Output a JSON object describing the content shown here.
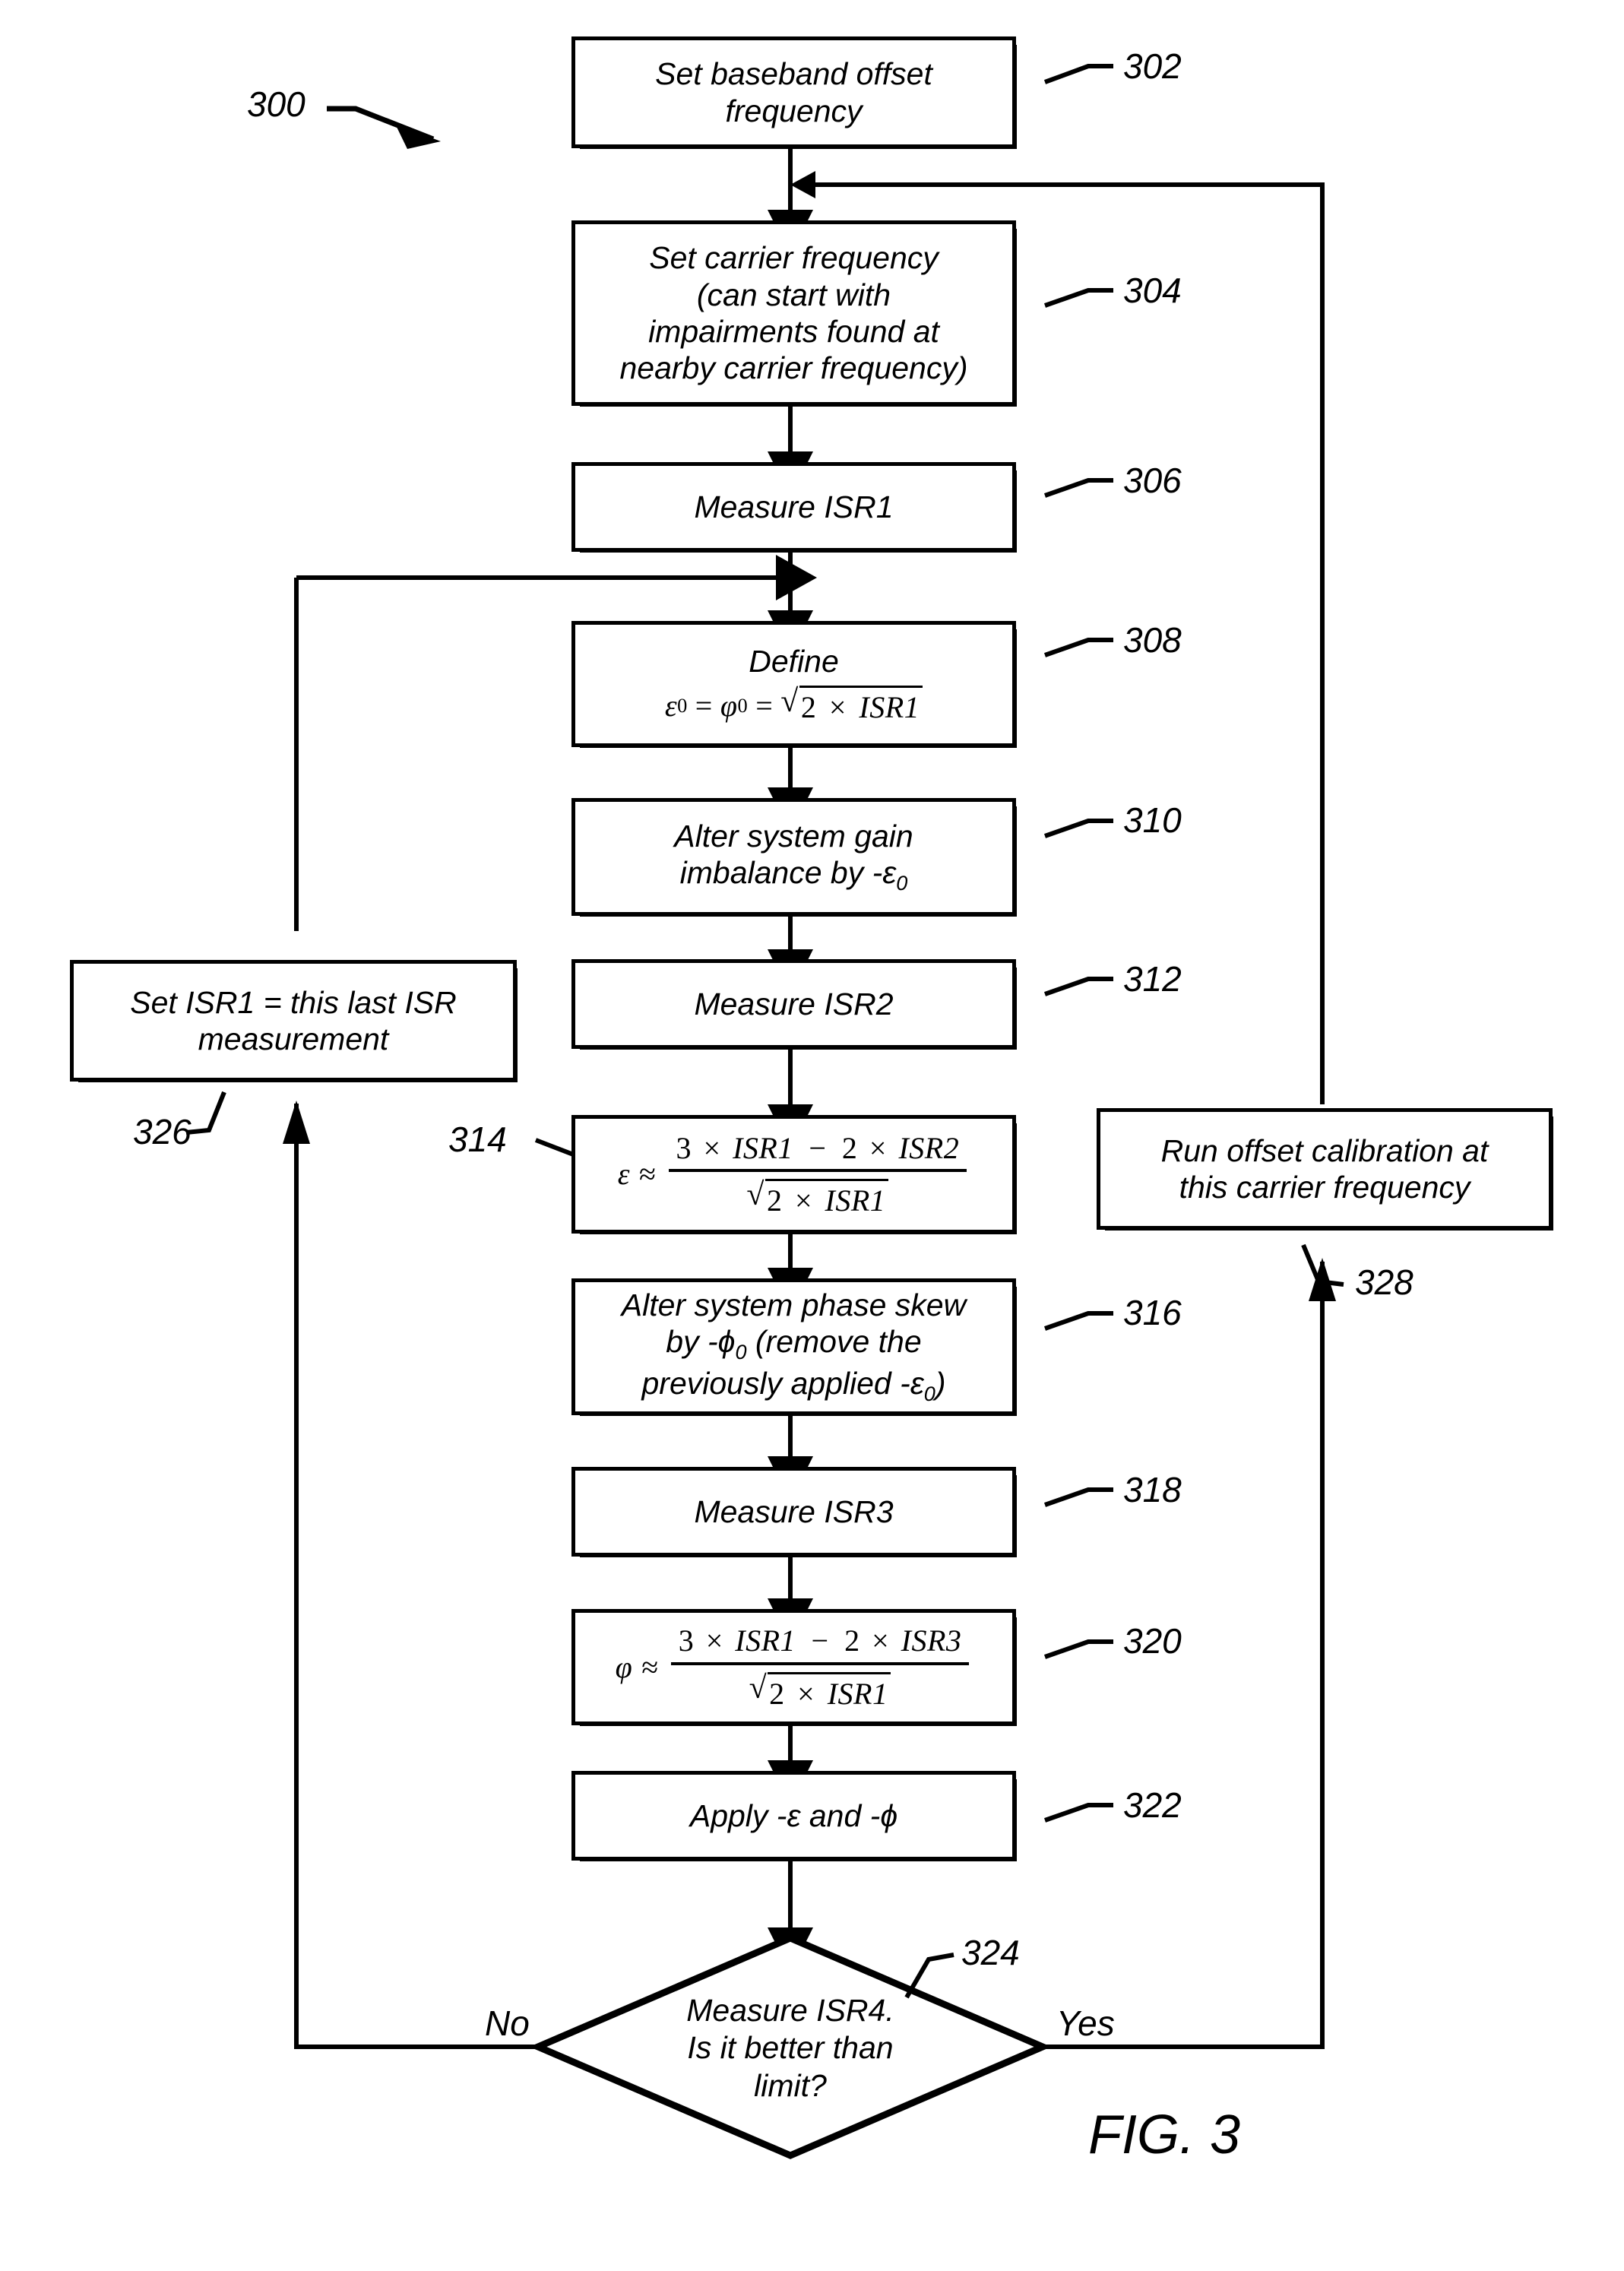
{
  "figure": {
    "caption": "FIG. 3",
    "diagram_ref": "300"
  },
  "nodes": [
    {
      "ref": "302",
      "name": "set-baseband-offset-frequency",
      "text": "Set baseband offset frequency"
    },
    {
      "ref": "304",
      "name": "set-carrier-frequency",
      "text": "Set carrier frequency (can start with impairments found at nearby carrier frequency)"
    },
    {
      "ref": "306",
      "name": "measure-isr1",
      "text": "Measure ISR1"
    },
    {
      "ref": "308",
      "name": "define-epsilon0-phi0",
      "text": "Define",
      "formula": "ε₀ = φ₀ = √(2 × ISR1)",
      "formula_parts": {
        "lhs": "ε",
        "lhs_sub": "0",
        "mid": "φ",
        "mid_sub": "0",
        "radicand": "2 × ISR1"
      }
    },
    {
      "ref": "310",
      "name": "alter-system-gain-imbalance",
      "text": "Alter system gain imbalance by -ε₀",
      "text_lines": [
        "Alter system gain",
        "imbalance by -ε",
        "0"
      ]
    },
    {
      "ref": "312",
      "name": "measure-isr2",
      "text": "Measure ISR2"
    },
    {
      "ref": "314",
      "name": "compute-epsilon",
      "formula": "ε ≈ (3 × ISR1 − 2 × ISR2) / √(2 × ISR1)",
      "formula_parts": {
        "lhs": "ε",
        "rel": "≈",
        "numerator": "3 × ISR1 − 2 × ISR2",
        "denominator_radicand": "2 × ISR1"
      }
    },
    {
      "ref": "316",
      "name": "alter-system-phase-skew",
      "text": "Alter system phase skew by -ϕ₀ (remove the previously applied -ε₀)"
    },
    {
      "ref": "318",
      "name": "measure-isr3",
      "text": "Measure ISR3"
    },
    {
      "ref": "320",
      "name": "compute-phi",
      "formula": "φ ≈ (3 × ISR1 − 2 × ISR3) / √(2 × ISR1)",
      "formula_parts": {
        "lhs": "φ",
        "rel": "≈",
        "numerator": "3 × ISR1 − 2 × ISR3",
        "denominator_radicand": "2 × ISR1"
      }
    },
    {
      "ref": "322",
      "name": "apply-epsilon-phi",
      "text": "Apply -ε and -ϕ"
    },
    {
      "ref": "324",
      "name": "measure-isr4-decision",
      "text": "Measure ISR4. Is it better than limit?",
      "shape": "decision"
    },
    {
      "ref": "326",
      "name": "set-isr1-last-measurement",
      "text": "Set ISR1 = this last ISR measurement"
    },
    {
      "ref": "328",
      "name": "run-offset-calibration",
      "text": "Run offset calibration at this carrier frequency"
    }
  ],
  "node_text": {
    "n302_l1": "Set baseband offset",
    "n302_l2": "frequency",
    "n304_l1": "Set carrier frequency",
    "n304_l2": "(can start with",
    "n304_l3": "impairments found at",
    "n304_l4": "nearby carrier frequency)",
    "n306": "Measure ISR1",
    "n308_title": "Define",
    "n310_l1": "Alter system gain",
    "n310_l2": "imbalance by -",
    "n312": "Measure ISR2",
    "n316_l1": "Alter system phase skew",
    "n316_l2a": "by -",
    "n316_l2b": " (remove the",
    "n316_l3a": "previously applied -",
    "n316_l3b": ")",
    "n318": "Measure ISR3",
    "n322": "Apply -ε and -ϕ",
    "n324_l1": "Measure ISR4.",
    "n324_l2": "Is it better than",
    "n324_l3": "limit?",
    "n326_l1": "Set ISR1 = this last ISR",
    "n326_l2": "measurement",
    "n328_l1": "Run offset calibration at",
    "n328_l2": "this carrier frequency"
  },
  "symbols": {
    "epsilon": "ε",
    "epsilon_sub0": "0",
    "phi_italic": "ϕ",
    "phi_math": "φ",
    "sub_zero": "0",
    "times": "×",
    "minus": "−",
    "approx": "≈",
    "equals": "=",
    "radical": "√",
    "three": "3",
    "two": "2",
    "isr1": "ISR1",
    "isr2": "ISR2",
    "isr3": "ISR3"
  },
  "refnums": {
    "r300": "300",
    "r302": "302",
    "r304": "304",
    "r306": "306",
    "r308": "308",
    "r310": "310",
    "r312": "312",
    "r314": "314",
    "r316": "316",
    "r318": "318",
    "r320": "320",
    "r322": "322",
    "r324": "324",
    "r326": "326",
    "r328": "328"
  },
  "edge_labels": {
    "no": "No",
    "yes": "Yes"
  },
  "colors": {
    "line": "#000000",
    "background": "#ffffff"
  },
  "chart_data": {
    "type": "flowchart",
    "title": "FIG. 3",
    "nodes": [
      {
        "id": "302",
        "shape": "process",
        "label": "Set baseband offset frequency"
      },
      {
        "id": "304",
        "shape": "process",
        "label": "Set carrier frequency (can start with impairments found at nearby carrier frequency)"
      },
      {
        "id": "306",
        "shape": "process",
        "label": "Measure ISR1"
      },
      {
        "id": "308",
        "shape": "process",
        "label": "Define e0 = phi0 = sqrt(2 x ISR1)"
      },
      {
        "id": "310",
        "shape": "process",
        "label": "Alter system gain imbalance by -e0"
      },
      {
        "id": "312",
        "shape": "process",
        "label": "Measure ISR2"
      },
      {
        "id": "314",
        "shape": "process",
        "label": "e ~ (3 x ISR1 - 2 x ISR2) / sqrt(2 x ISR1)"
      },
      {
        "id": "316",
        "shape": "process",
        "label": "Alter system phase skew by -phi0 (remove the previously applied -e0)"
      },
      {
        "id": "318",
        "shape": "process",
        "label": "Measure ISR3"
      },
      {
        "id": "320",
        "shape": "process",
        "label": "phi ~ (3 x ISR1 - 2 x ISR3) / sqrt(2 x ISR1)"
      },
      {
        "id": "322",
        "shape": "process",
        "label": "Apply -e and -phi"
      },
      {
        "id": "324",
        "shape": "decision",
        "label": "Measure ISR4. Is it better than limit?"
      },
      {
        "id": "326",
        "shape": "process",
        "label": "Set ISR1 = this last ISR measurement"
      },
      {
        "id": "328",
        "shape": "process",
        "label": "Run offset calibration at this carrier frequency"
      }
    ],
    "edges": [
      {
        "from": "302",
        "to": "304",
        "label": ""
      },
      {
        "from": "304",
        "to": "306",
        "label": ""
      },
      {
        "from": "306",
        "to": "308",
        "label": ""
      },
      {
        "from": "308",
        "to": "310",
        "label": ""
      },
      {
        "from": "310",
        "to": "312",
        "label": ""
      },
      {
        "from": "312",
        "to": "314",
        "label": ""
      },
      {
        "from": "314",
        "to": "316",
        "label": ""
      },
      {
        "from": "316",
        "to": "318",
        "label": ""
      },
      {
        "from": "318",
        "to": "320",
        "label": ""
      },
      {
        "from": "320",
        "to": "322",
        "label": ""
      },
      {
        "from": "322",
        "to": "324",
        "label": ""
      },
      {
        "from": "324",
        "to": "326",
        "label": "No"
      },
      {
        "from": "326",
        "to": "308",
        "label": ""
      },
      {
        "from": "324",
        "to": "328",
        "label": "Yes"
      },
      {
        "from": "328",
        "to": "304",
        "label": ""
      }
    ]
  }
}
